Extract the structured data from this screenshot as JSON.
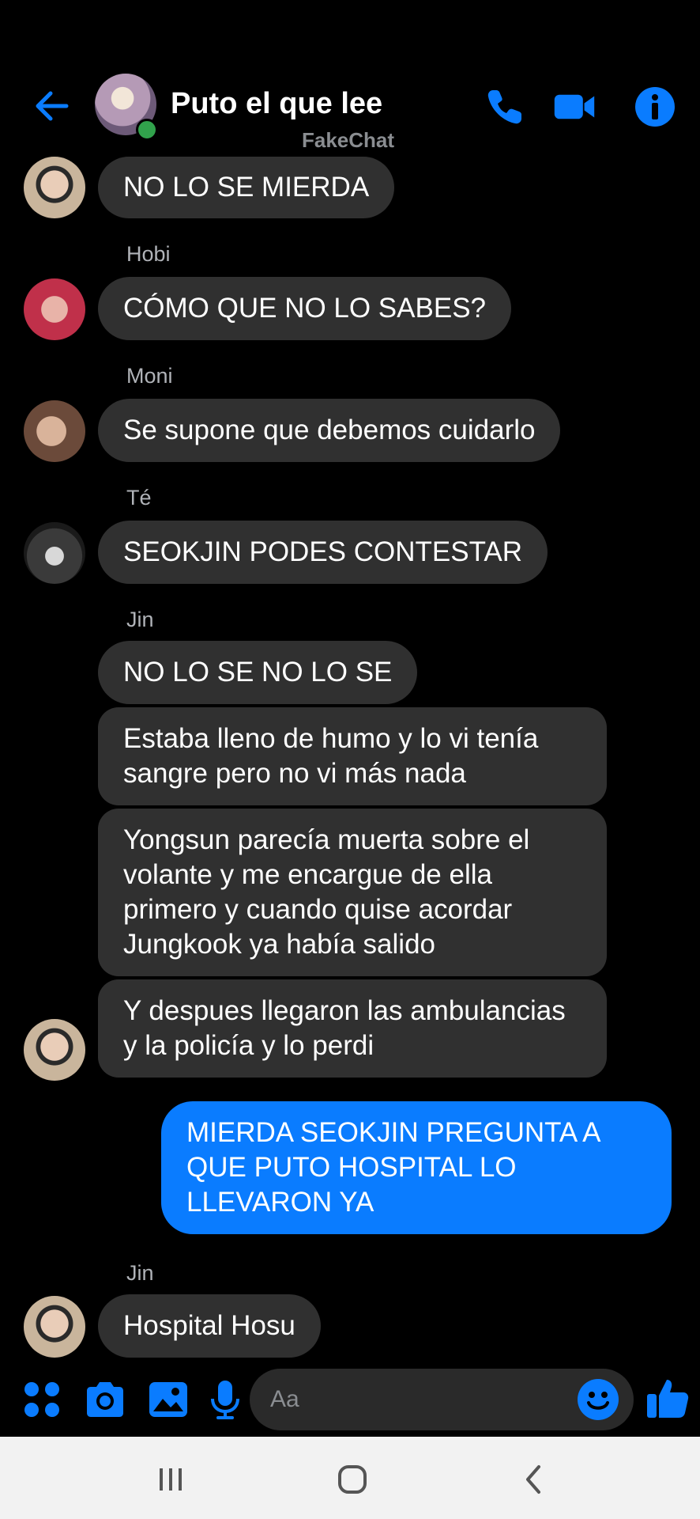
{
  "header": {
    "title": "Puto el que lee",
    "watermark": "FakeChat",
    "accent": "#0a7cff",
    "online_color": "#31a24c"
  },
  "messages": [
    {
      "sender": "",
      "text": "NO LO SE MIERDA"
    },
    {
      "sender": "Hobi",
      "text": "CÓMO QUE NO LO SABES?"
    },
    {
      "sender": "Moni",
      "text": "Se supone que debemos cuidarlo"
    },
    {
      "sender": "Té",
      "text": "SEOKJIN PODES CONTESTAR"
    },
    {
      "sender": "Jin",
      "text": "NO LO SE NO LO SE"
    },
    {
      "sender": "",
      "text": "Estaba lleno de humo y lo vi tenía sangre pero no vi más nada"
    },
    {
      "sender": "",
      "text": "Yongsun parecía muerta sobre el volante y me encargue de ella primero y cuando quise acordar Jungkook ya había salido"
    },
    {
      "sender": "",
      "text": "Y despues llegaron las ambulancias y la policía y lo perdi"
    },
    {
      "sender": "me",
      "text": "MIERDA SEOKJIN PREGUNTA A QUE PUTO HOSPITAL LO LLEVARON YA"
    },
    {
      "sender": "Jin",
      "text": "Hospital Hosu"
    }
  ],
  "composer": {
    "placeholder": "Aa"
  },
  "icons": {
    "back": "arrow-left-icon",
    "call": "phone-icon",
    "video": "video-camera-icon",
    "info": "info-icon",
    "apps": "grid-dots-icon",
    "camera": "camera-icon",
    "gallery": "image-icon",
    "mic": "microphone-icon",
    "emoji": "smiley-icon",
    "like": "thumbs-up-icon"
  }
}
